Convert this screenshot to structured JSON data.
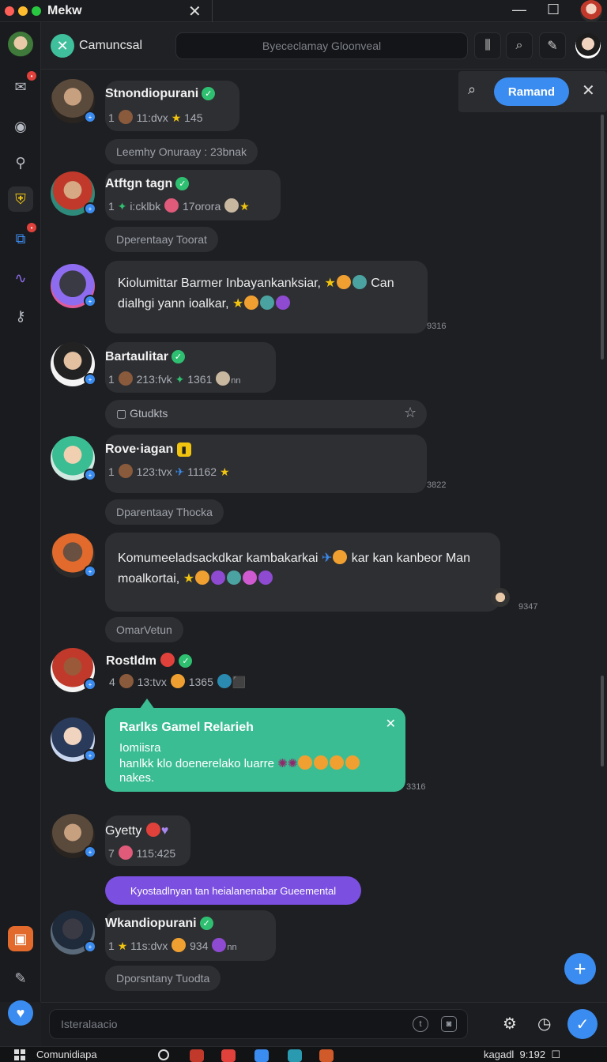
{
  "window": {
    "title": "Mekw"
  },
  "header": {
    "channel_name": "Camuncsal",
    "search_placeholder": "Byececlamay Gloonveal"
  },
  "panel": {
    "button_label": "Ramand"
  },
  "messages": [
    {
      "username": "Stnondiopurani",
      "meta_a": "1",
      "meta_b": "11:dvx",
      "meta_c": "145",
      "pill": "Leemhy Onuraay : 23bnak"
    },
    {
      "username": "Atftgn tagn",
      "meta_a": "1",
      "meta_b": "i:cklbk",
      "meta_c": "17orora",
      "pill": "Dperentaay Toorat"
    },
    {
      "text_a": "Kiolumittar Barmer Inbayankanksiar,",
      "text_b": "Can dialhgi yann ioalkar,",
      "time": "9316"
    },
    {
      "username": "Bartaulitar",
      "meta_a": "1",
      "meta_b": "213:fvk",
      "meta_c": "1361",
      "meta_d": "nn",
      "attachment": "Gtudkts"
    },
    {
      "username": "Rove·iagan",
      "meta_a": "1",
      "meta_b": "123:tvx",
      "meta_c": "11162",
      "time": "3822",
      "pill": "Dparentaay Thocka"
    },
    {
      "text_a": "Komumeeladsackdkar kambakarkai",
      "text_b": "kar kan kanbeor Man moalkortai,",
      "time": "9347",
      "pill": "OmarVetun"
    },
    {
      "username": "Rostldm",
      "meta_a": "4",
      "meta_b": "13:tvx",
      "meta_c": "1365"
    },
    {
      "username": "Gyetty",
      "meta_a": "7",
      "meta_b": "115:425",
      "pill": "Kyostadlnyan tan heialanenabar Gueemental"
    },
    {
      "username": "Wkandiopurani",
      "meta_a": "1",
      "meta_b": "11s:dvx",
      "meta_c": "934",
      "meta_d": "nn",
      "pill": "Dporsntany Tuodta"
    }
  ],
  "highlight": {
    "title": "Rarlks Gamel Relarieh",
    "line1": "Iomiisra",
    "line2": "hanlkk klo doenerelako luarre",
    "line3": "nakes.",
    "time": "3316"
  },
  "composer": {
    "placeholder": "Isteralaacio"
  },
  "taskbar": {
    "label": "Comunidiapa",
    "tray_label": "kagadl",
    "clock": "9:192"
  },
  "colors": {
    "accent": "#3b8cf0",
    "teal": "#3bbd93",
    "purple": "#7b4fe0",
    "verified": "#2fbf71",
    "background": "#1e1f22"
  }
}
